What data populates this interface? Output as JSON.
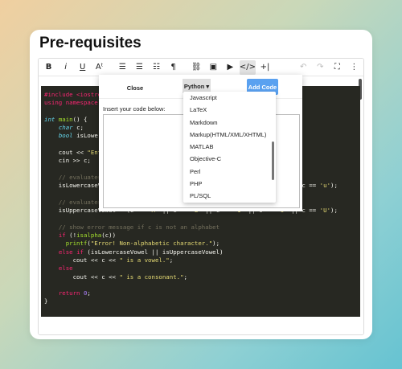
{
  "page": {
    "title": "Pre-requisites"
  },
  "toolbar": {
    "bold": "B",
    "italic": "i",
    "underline": "U",
    "font_size": "Aᵗ",
    "align_left": "☰",
    "align_center": "☰",
    "list": "☷",
    "paragraph": "¶",
    "link": "⛓",
    "image": "▣",
    "video": "▶",
    "code": "</>",
    "insert": "+|",
    "undo": "↶",
    "redo": "↷",
    "fullscreen": "⛶",
    "more": "⋮"
  },
  "modal": {
    "close_label": "Close",
    "language_label": "Python ▾",
    "add_label": "Add Code",
    "insert_label": "Insert your code below:",
    "textarea_value": ""
  },
  "dropdown": {
    "options": [
      "Javascript",
      "LaTeX",
      "Markdown",
      "Markup(HTML/XML/XHTML)",
      "MATLAB",
      "Objective-C",
      "Perl",
      "PHP",
      "PL/SQL"
    ]
  },
  "code": {
    "lines": [
      "#include <iostream>",
      "using namespace std;",
      "",
      "int main() {",
      "    char c;",
      "    bool isLowercaseVowel, isUppercaseVowel;",
      "",
      "    cout << \"Enter an alphabet: \";",
      "    cin >> c;",
      "",
      "    // evaluates to 1 (true) if c is a lowercase vowel",
      "    isLowercaseVowel = (c == 'a' || c == 'e' || c == 'i' || c == 'o' || c == 'u');",
      "",
      "    // evaluates to 1 (true) if c is an uppercase vowel",
      "    isUppercaseVowel = (c == 'A' || c == 'E' || c == 'I' || c == 'O' || c == 'U');",
      "",
      "    // show error message if c is not an alphabet",
      "    if (!isalpha(c))",
      "      printf(\"Error! Non-alphabetic character.\");",
      "    else if (isLowercaseVowel || isUppercaseVowel)",
      "        cout << c << \" is a vowel.\";",
      "    else",
      "        cout << c << \" is a consonant.\";",
      "",
      "    return 0;",
      "}"
    ]
  },
  "colors": {
    "code_bg": "#272822",
    "accent": "#5aa1f0",
    "keyword": "#66d9ef",
    "string": "#e6db74",
    "comment": "#75715e",
    "preprocessor": "#f92672"
  }
}
